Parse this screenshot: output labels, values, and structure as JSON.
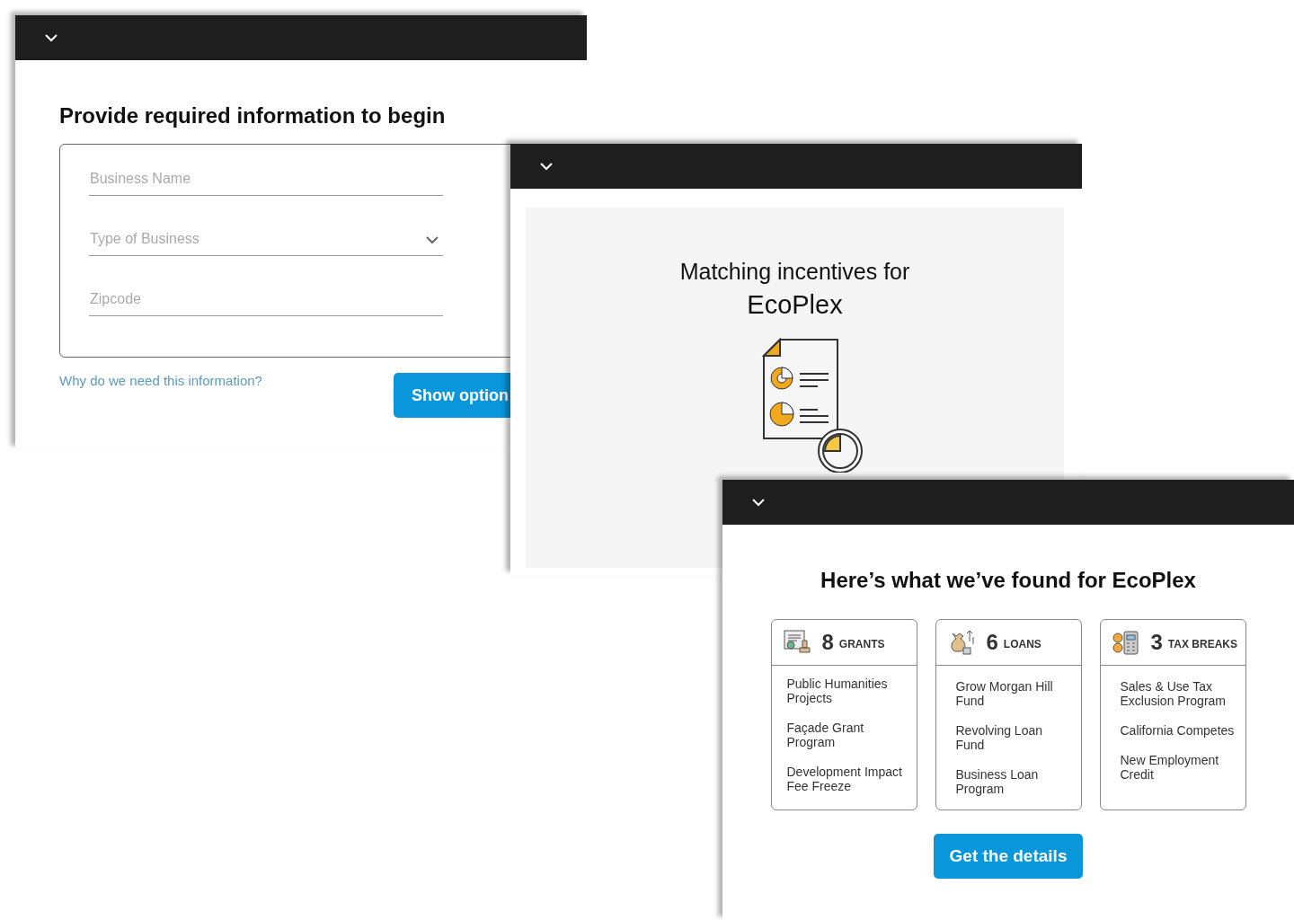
{
  "windows": [
    {
      "kind": "form",
      "heading": "Provide required information to begin",
      "fields": [
        {
          "kind": "text",
          "placeholder": "Business Name"
        },
        {
          "kind": "select",
          "placeholder": "Type of Business"
        },
        {
          "kind": "text",
          "placeholder": "Zipcode"
        }
      ],
      "help_link": "Why do we need this information?",
      "button": "Show option"
    },
    {
      "kind": "matching",
      "line": "Matching incentives for",
      "company": "EcoPlex"
    },
    {
      "kind": "results",
      "title": "Here’s what we’ve found for EcoPlex",
      "categories": [
        {
          "kind": "grants",
          "count": "8",
          "label": "GRANTS",
          "items": [
            "Public Humanities Projects",
            "Façade Grant Program",
            "Development Impact Fee Freeze"
          ]
        },
        {
          "kind": "loans",
          "count": "6",
          "label": "LOANS",
          "items": [
            "Grow Morgan Hill Fund",
            "Revolving Loan Fund",
            "Business Loan Program"
          ]
        },
        {
          "kind": "tax",
          "count": "3",
          "label": "TAX BREAKS",
          "items": [
            "Sales & Use Tax Exclusion Program",
            "California Competes",
            "New Employment Credit"
          ]
        }
      ],
      "button": "Get the details"
    }
  ]
}
